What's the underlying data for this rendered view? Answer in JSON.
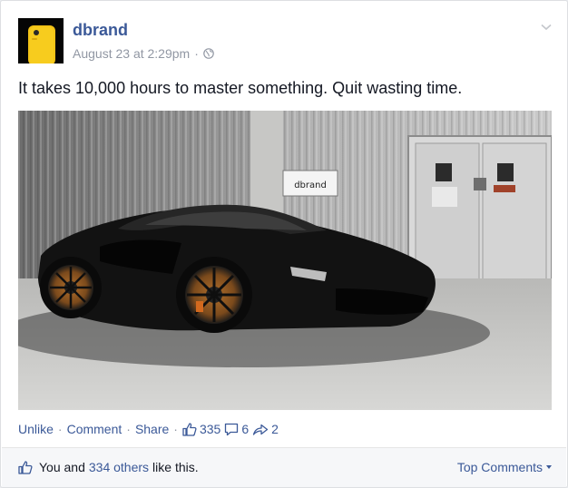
{
  "post": {
    "author": "dbrand",
    "timestamp": "August 23 at 2:29pm",
    "meta_separator": "·",
    "privacy_icon": "globe-icon",
    "message": "It takes 10,000 hours to master something. Quit wasting time.",
    "photo_sign_text": "dbrand"
  },
  "actions": {
    "unlike": "Unlike",
    "comment": "Comment",
    "share": "Share",
    "separator": "·",
    "likes_count": "335",
    "comments_count": "6",
    "shares_count": "2"
  },
  "likes_summary": {
    "prefix": "You and",
    "others_link": "334 others",
    "suffix": "like this."
  },
  "comments_sort": {
    "label": "Top Comments"
  },
  "colors": {
    "link": "#3b5998",
    "meta": "#9197a3",
    "text": "#141823",
    "footer_bg": "#f6f7f9"
  }
}
